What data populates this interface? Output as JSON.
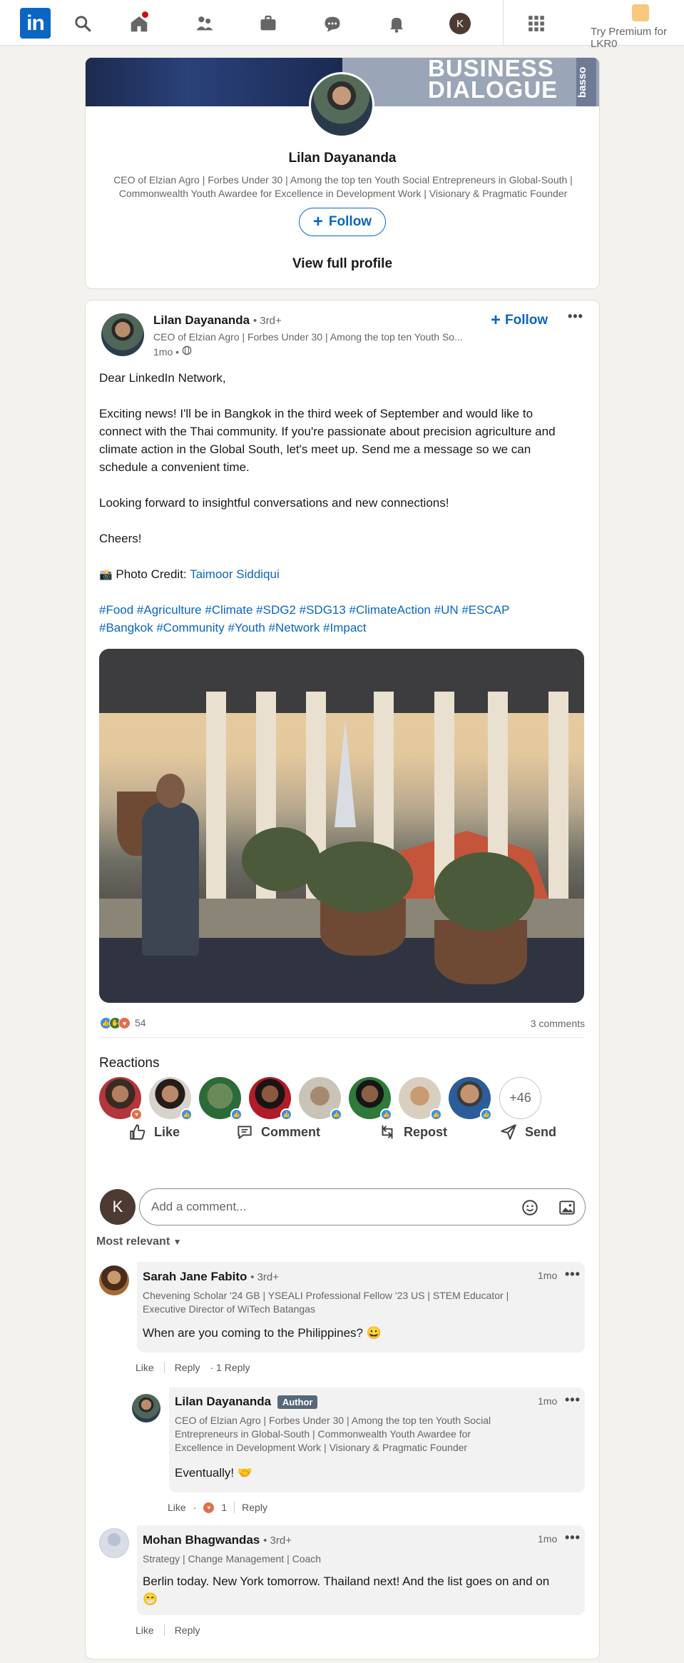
{
  "nav": {
    "logo": "in",
    "icons": [
      "search-icon",
      "home-icon",
      "my-network-icon",
      "jobs-icon",
      "messaging-icon",
      "notifications-icon",
      "me-avatar",
      "work-grid-icon"
    ],
    "me_initial": "K",
    "premium_label": "Try Premium for LKR0"
  },
  "profile_card": {
    "banner_text_line1": "BUSINESS",
    "banner_text_line2": "DIALOGUE",
    "banner_side": "basso",
    "name": "Lilan Dayananda",
    "headline_line1": "CEO of Elzian Agro | Forbes Under 30 | Among the top ten Youth Social Entrepreneurs in Global-South |",
    "headline_line2": "Commonwealth Youth Awardee for Excellence in Development Work | Visionary & Pragmatic Founder",
    "follow_label": "Follow",
    "view_profile_label": "View full profile"
  },
  "post": {
    "author_name": "Lilan Dayananda",
    "author_degree": "• 3rd+",
    "author_headline": "CEO of Elzian Agro | Forbes Under 30 | Among the top ten Youth So...",
    "time": "1mo •",
    "follow_label": "Follow",
    "greeting": "Dear LinkedIn Network,",
    "para1_line1": "Exciting news! I'll be in Bangkok in the third week of September and would like to",
    "para1_line2": "connect with the Thai community. If you're passionate about precision agriculture and",
    "para1_line3": "climate action in the Global South, let's meet up. Send me a message so we can",
    "para1_line4": "schedule a convenient time.",
    "para2": "Looking forward to insightful conversations and new connections!",
    "para3": "Cheers!",
    "credit_prefix": "Photo Credit: ",
    "credit_name": "Taimoor Siddiqui",
    "hashtags_line1": "#Food #Agriculture #Climate #SDG2 #SDG13 #ClimateAction #UN #ESCAP",
    "hashtags_line2": "#Bangkok #Community #Youth #Network #Impact",
    "reaction_count": "54",
    "comments_count": "3 comments",
    "reactions_title": "Reactions",
    "more_reactors": "+46",
    "actions": {
      "like": "Like",
      "comment": "Comment",
      "repost": "Repost",
      "send": "Send"
    },
    "comment_placeholder": "Add a comment...",
    "me_initial": "K",
    "sort_label": "Most relevant"
  },
  "comments": [
    {
      "name": "Sarah Jane Fabito",
      "degree": "• 3rd+",
      "headline_line1": "Chevening Scholar '24 GB | YSEALI Professional Fellow '23 US | STEM Educator |",
      "headline_line2": "Executive Director of WiTech Batangas",
      "time": "1mo",
      "text": "When are you coming to the Philippines? 😀",
      "like": "Like",
      "reply": "Reply",
      "reply_count": "· 1 Reply"
    },
    {
      "name": "Lilan Dayananda",
      "author_badge": "Author",
      "headline_line1": "CEO of Elzian Agro | Forbes Under 30 | Among the top ten Youth Social",
      "headline_line2": "Entrepreneurs in Global-South | Commonwealth Youth Awardee for",
      "headline_line3": "Excellence in Development Work | Visionary & Pragmatic Founder",
      "time": "1mo",
      "text": "Eventually! 🤝",
      "like": "Like",
      "like_count": "1",
      "reply": "Reply"
    },
    {
      "name": "Mohan Bhagwandas",
      "degree": "• 3rd+",
      "headline_line1": "Strategy | Change Management | Coach",
      "time": "1mo",
      "text_line1": "Berlin today. New York tomorrow. Thailand next! And the list goes on and on",
      "text_line2": "😁",
      "like": "Like",
      "reply": "Reply"
    }
  ],
  "colors": {
    "brand": "#0a66c2",
    "background": "#f4f2ee",
    "notification": "#cc1016"
  }
}
